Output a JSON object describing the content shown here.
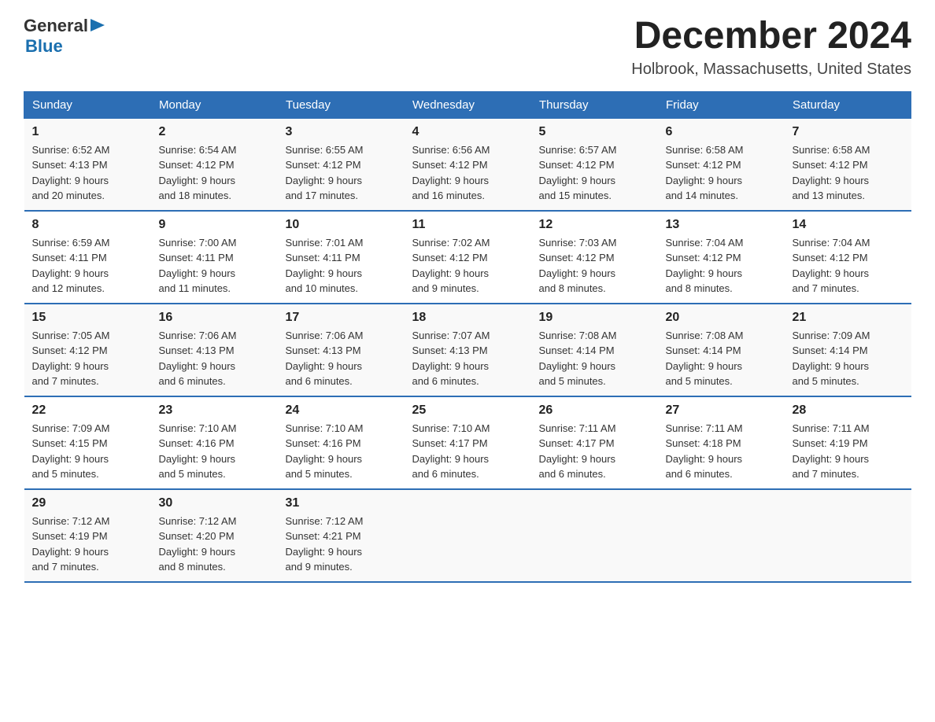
{
  "logo": {
    "text_general": "General",
    "arrow": "▶",
    "text_blue": "Blue"
  },
  "header": {
    "month_title": "December 2024",
    "location": "Holbrook, Massachusetts, United States"
  },
  "weekdays": [
    "Sunday",
    "Monday",
    "Tuesday",
    "Wednesday",
    "Thursday",
    "Friday",
    "Saturday"
  ],
  "weeks": [
    [
      {
        "day": "1",
        "sunrise": "6:52 AM",
        "sunset": "4:13 PM",
        "daylight": "9 hours and 20 minutes."
      },
      {
        "day": "2",
        "sunrise": "6:54 AM",
        "sunset": "4:12 PM",
        "daylight": "9 hours and 18 minutes."
      },
      {
        "day": "3",
        "sunrise": "6:55 AM",
        "sunset": "4:12 PM",
        "daylight": "9 hours and 17 minutes."
      },
      {
        "day": "4",
        "sunrise": "6:56 AM",
        "sunset": "4:12 PM",
        "daylight": "9 hours and 16 minutes."
      },
      {
        "day": "5",
        "sunrise": "6:57 AM",
        "sunset": "4:12 PM",
        "daylight": "9 hours and 15 minutes."
      },
      {
        "day": "6",
        "sunrise": "6:58 AM",
        "sunset": "4:12 PM",
        "daylight": "9 hours and 14 minutes."
      },
      {
        "day": "7",
        "sunrise": "6:58 AM",
        "sunset": "4:12 PM",
        "daylight": "9 hours and 13 minutes."
      }
    ],
    [
      {
        "day": "8",
        "sunrise": "6:59 AM",
        "sunset": "4:11 PM",
        "daylight": "9 hours and 12 minutes."
      },
      {
        "day": "9",
        "sunrise": "7:00 AM",
        "sunset": "4:11 PM",
        "daylight": "9 hours and 11 minutes."
      },
      {
        "day": "10",
        "sunrise": "7:01 AM",
        "sunset": "4:11 PM",
        "daylight": "9 hours and 10 minutes."
      },
      {
        "day": "11",
        "sunrise": "7:02 AM",
        "sunset": "4:12 PM",
        "daylight": "9 hours and 9 minutes."
      },
      {
        "day": "12",
        "sunrise": "7:03 AM",
        "sunset": "4:12 PM",
        "daylight": "9 hours and 8 minutes."
      },
      {
        "day": "13",
        "sunrise": "7:04 AM",
        "sunset": "4:12 PM",
        "daylight": "9 hours and 8 minutes."
      },
      {
        "day": "14",
        "sunrise": "7:04 AM",
        "sunset": "4:12 PM",
        "daylight": "9 hours and 7 minutes."
      }
    ],
    [
      {
        "day": "15",
        "sunrise": "7:05 AM",
        "sunset": "4:12 PM",
        "daylight": "9 hours and 7 minutes."
      },
      {
        "day": "16",
        "sunrise": "7:06 AM",
        "sunset": "4:13 PM",
        "daylight": "9 hours and 6 minutes."
      },
      {
        "day": "17",
        "sunrise": "7:06 AM",
        "sunset": "4:13 PM",
        "daylight": "9 hours and 6 minutes."
      },
      {
        "day": "18",
        "sunrise": "7:07 AM",
        "sunset": "4:13 PM",
        "daylight": "9 hours and 6 minutes."
      },
      {
        "day": "19",
        "sunrise": "7:08 AM",
        "sunset": "4:14 PM",
        "daylight": "9 hours and 5 minutes."
      },
      {
        "day": "20",
        "sunrise": "7:08 AM",
        "sunset": "4:14 PM",
        "daylight": "9 hours and 5 minutes."
      },
      {
        "day": "21",
        "sunrise": "7:09 AM",
        "sunset": "4:14 PM",
        "daylight": "9 hours and 5 minutes."
      }
    ],
    [
      {
        "day": "22",
        "sunrise": "7:09 AM",
        "sunset": "4:15 PM",
        "daylight": "9 hours and 5 minutes."
      },
      {
        "day": "23",
        "sunrise": "7:10 AM",
        "sunset": "4:16 PM",
        "daylight": "9 hours and 5 minutes."
      },
      {
        "day": "24",
        "sunrise": "7:10 AM",
        "sunset": "4:16 PM",
        "daylight": "9 hours and 5 minutes."
      },
      {
        "day": "25",
        "sunrise": "7:10 AM",
        "sunset": "4:17 PM",
        "daylight": "9 hours and 6 minutes."
      },
      {
        "day": "26",
        "sunrise": "7:11 AM",
        "sunset": "4:17 PM",
        "daylight": "9 hours and 6 minutes."
      },
      {
        "day": "27",
        "sunrise": "7:11 AM",
        "sunset": "4:18 PM",
        "daylight": "9 hours and 6 minutes."
      },
      {
        "day": "28",
        "sunrise": "7:11 AM",
        "sunset": "4:19 PM",
        "daylight": "9 hours and 7 minutes."
      }
    ],
    [
      {
        "day": "29",
        "sunrise": "7:12 AM",
        "sunset": "4:19 PM",
        "daylight": "9 hours and 7 minutes."
      },
      {
        "day": "30",
        "sunrise": "7:12 AM",
        "sunset": "4:20 PM",
        "daylight": "9 hours and 8 minutes."
      },
      {
        "day": "31",
        "sunrise": "7:12 AM",
        "sunset": "4:21 PM",
        "daylight": "9 hours and 9 minutes."
      },
      null,
      null,
      null,
      null
    ]
  ],
  "labels": {
    "sunrise": "Sunrise:",
    "sunset": "Sunset:",
    "daylight": "Daylight:"
  }
}
